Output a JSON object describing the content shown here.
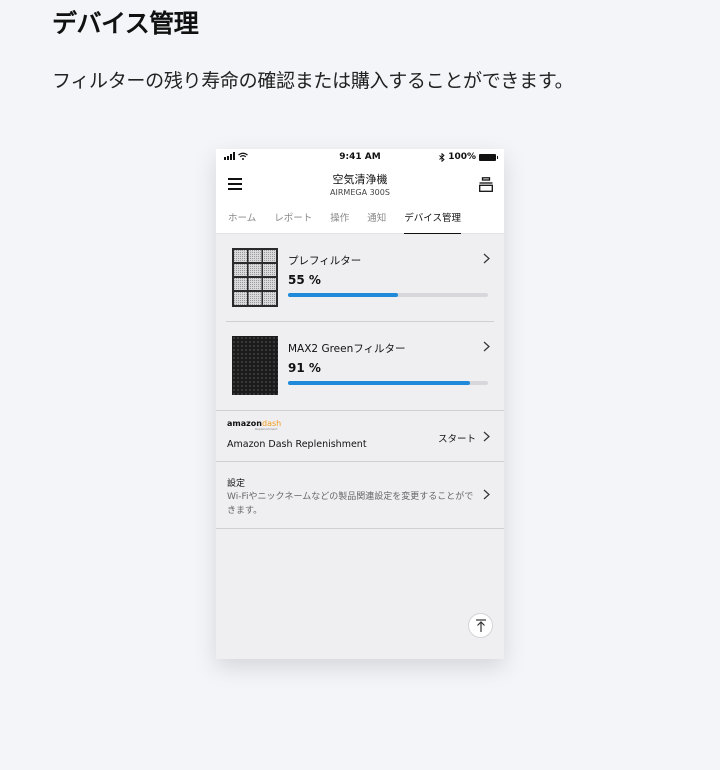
{
  "page": {
    "heading": "デバイス管理",
    "subheading": "フィルターの残り寿命の確認または購入することができます。"
  },
  "status_bar": {
    "time": "9:41 AM",
    "battery": "100%",
    "icons": [
      "signal-icon",
      "wifi-icon",
      "bluetooth-icon",
      "battery-icon"
    ]
  },
  "header": {
    "title": "空気清浄機",
    "subtitle": "AIRMEGA 300S",
    "left_icon": "menu-icon",
    "right_icon": "device-icon"
  },
  "tabs": [
    {
      "label": "ホーム",
      "active": false
    },
    {
      "label": "レポート",
      "active": false
    },
    {
      "label": "操作",
      "active": false
    },
    {
      "label": "通知",
      "active": false
    },
    {
      "label": "デバイス管理",
      "active": true
    }
  ],
  "filters": [
    {
      "name": "プレフィルター",
      "percent_label": "55 %",
      "level": 0.55,
      "image": "pre-filter-image"
    },
    {
      "name": "MAX2 Greenフィルター",
      "percent_label": "91 %",
      "level": 0.91,
      "image": "max2-filter-image"
    }
  ],
  "amazon": {
    "logo_text": "amazon",
    "logo_dash": "dash",
    "logo_tag": "Replenishment",
    "label": "Amazon Dash Replenishment",
    "action": "スタート"
  },
  "settings": {
    "title": "設定",
    "description": "Wi-Fiやニックネームなどの製品関連設定を変更することができます。"
  },
  "colors": {
    "accent": "#1f8ad9",
    "page_background": "#f3f5f9",
    "phone_background": "#efeff2",
    "amazon_dash": "#f29a1b"
  }
}
